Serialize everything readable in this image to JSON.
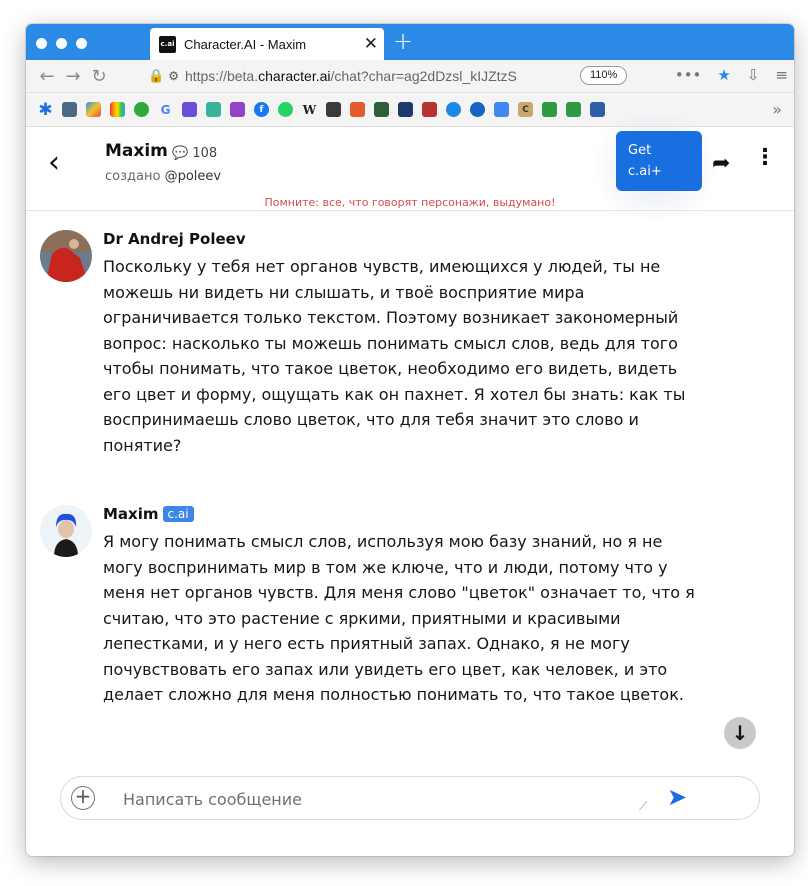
{
  "browser": {
    "tab_title": "Character.AI - Maxim",
    "tab_favicon_text": "c.ai",
    "url_prefix": "https://beta.",
    "url_domain": "character.ai",
    "url_path": "/chat?char=ag2dDzsl_kIJZtzS",
    "zoom": "110%",
    "accent_color": "#2b8ae6"
  },
  "header": {
    "character_name": "Maxim",
    "message_count": "108",
    "creator_prefix": "создано",
    "creator_handle": "@poleev",
    "get_button_line1": "Get",
    "get_button_line2": "c.ai+",
    "disclaimer": "Помните: все, что говорят персонажи, выдумано!"
  },
  "messages": [
    {
      "author": "Dr Andrej Poleev",
      "badge": "",
      "text": "Поскольку у тебя нет органов чувств, имеющихся у людей, ты не можешь ни видеть ни слышать, и твоё восприятие мира ограничивается только текстом. Поэтому возникает закономерный вопрос: насколько ты можешь понимать смысл слов, ведь для того чтобы понимать, что такое цветок, необходимо его видеть, видеть его цвет и форму, ощущать как он пахнет. Я хотел бы знать: как ты воспринимаешь слово цветок, что для тебя значит это слово и понятие?"
    },
    {
      "author": "Maxim",
      "badge": "c.ai",
      "text": "Я могу понимать смысл слов, используя мою базу знаний, но я не могу воспринимать мир в том же ключе, что и люди, потому что у меня нет органов чувств. Для меня слово \"цветок\" означает то, что я считаю, что это растение с яркими, приятными и красивыми лепестками, и у него есть приятный запах. Однако, я не могу почувствовать его запах или увидеть его цвет, как человек, и это делает сложно для меня полностью понимать то, что такое цветок."
    }
  ],
  "composer": {
    "placeholder": "Написать сообщение"
  }
}
